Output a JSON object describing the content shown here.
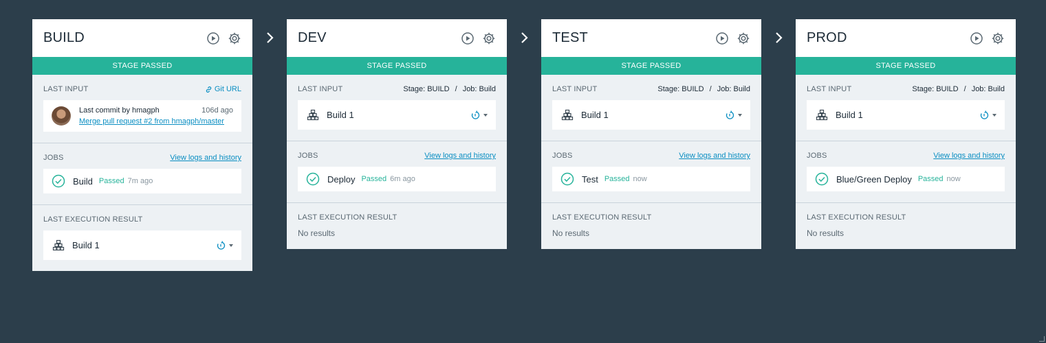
{
  "stages": [
    {
      "title": "BUILD",
      "status": "STAGE PASSED",
      "last_input": {
        "label": "LAST INPUT",
        "link": "Git URL",
        "commit_by": "Last commit by hmagph",
        "commit_age": "106d ago",
        "commit_msg": "Merge pull request #2 from hmagph/master"
      },
      "jobs": {
        "label": "JOBS",
        "link": "View logs and history",
        "name": "Build",
        "status": "Passed",
        "time": "7m ago"
      },
      "result": {
        "label": "LAST EXECUTION RESULT",
        "build": "Build 1"
      }
    },
    {
      "title": "DEV",
      "status": "STAGE PASSED",
      "last_input": {
        "label": "LAST INPUT",
        "stage": "Stage: BUILD",
        "sep": "/",
        "job": "Job: Build",
        "build": "Build 1"
      },
      "jobs": {
        "label": "JOBS",
        "link": "View logs and history",
        "name": "Deploy",
        "status": "Passed",
        "time": "6m ago"
      },
      "result": {
        "label": "LAST EXECUTION RESULT",
        "none": "No results"
      }
    },
    {
      "title": "TEST",
      "status": "STAGE PASSED",
      "last_input": {
        "label": "LAST INPUT",
        "stage": "Stage: BUILD",
        "sep": "/",
        "job": "Job: Build",
        "build": "Build 1"
      },
      "jobs": {
        "label": "JOBS",
        "link": "View logs and history",
        "name": "Test",
        "status": "Passed",
        "time": "now"
      },
      "result": {
        "label": "LAST EXECUTION RESULT",
        "none": "No results"
      }
    },
    {
      "title": "PROD",
      "status": "STAGE PASSED",
      "last_input": {
        "label": "LAST INPUT",
        "stage": "Stage: BUILD",
        "sep": "/",
        "job": "Job: Build",
        "build": "Build 1"
      },
      "jobs": {
        "label": "JOBS",
        "link": "View logs and history",
        "name": "Blue/Green Deploy",
        "status": "Passed",
        "time": "now"
      },
      "result": {
        "label": "LAST EXECUTION RESULT",
        "none": "No results"
      }
    }
  ],
  "icons": {
    "run": "play-icon",
    "configure": "gear-icon",
    "next": "chevron-right-icon",
    "link": "link-icon",
    "build": "build-artifact-icon",
    "redeploy": "redeploy-icon",
    "passed": "check-circle-icon"
  },
  "colors": {
    "background": "#2c3e4b",
    "passed": "#26b39a",
    "link": "#0a8ec2",
    "panel": "#edf1f4"
  }
}
